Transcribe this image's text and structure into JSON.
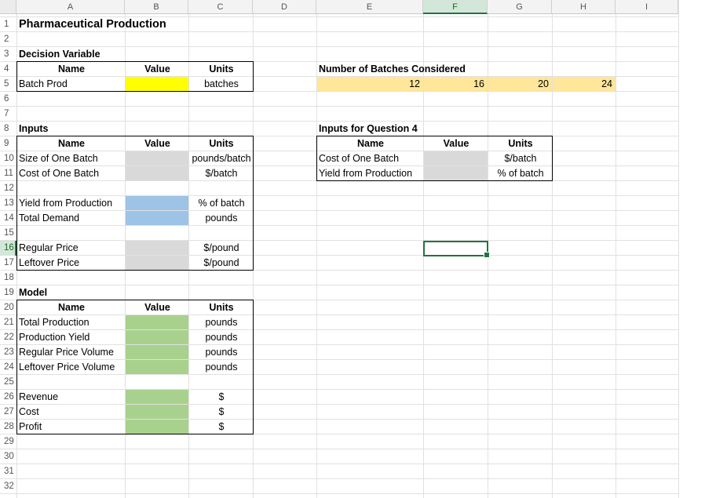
{
  "columns": [
    "A",
    "B",
    "C",
    "D",
    "E",
    "F",
    "G",
    "H",
    "I"
  ],
  "rows": [
    "1",
    "2",
    "3",
    "4",
    "5",
    "6",
    "7",
    "8",
    "9",
    "10",
    "11",
    "12",
    "13",
    "14",
    "15",
    "16",
    "17",
    "18",
    "19",
    "20",
    "21",
    "22",
    "23",
    "24",
    "25",
    "26",
    "27",
    "28",
    "29",
    "30",
    "31",
    "32"
  ],
  "title": "Pharmaceutical Production",
  "decision": {
    "heading": "Decision Variable",
    "name_header": "Name",
    "value_header": "Value",
    "units_header": "Units",
    "rows": [
      {
        "name": "Batch Prod",
        "units": "batches",
        "fill": "#ffff00"
      }
    ]
  },
  "inputs": {
    "heading": "Inputs",
    "name_header": "Name",
    "value_header": "Value",
    "units_header": "Units",
    "rows": [
      {
        "name": "Size of One Batch",
        "units": "pounds/batch",
        "fill": "#d9d9d9"
      },
      {
        "name": "Cost of One Batch",
        "units": "$/batch",
        "fill": "#d9d9d9"
      },
      {
        "name": "Yield from Production",
        "units": "% of batch",
        "fill": "#9dc3e6"
      },
      {
        "name": "Total Demand",
        "units": "pounds",
        "fill": "#9dc3e6"
      },
      {
        "name": "Regular Price",
        "units": "$/pound",
        "fill": "#d9d9d9"
      },
      {
        "name": "Leftover Price",
        "units": "$/pound",
        "fill": "#d9d9d9"
      }
    ]
  },
  "model": {
    "heading": "Model",
    "name_header": "Name",
    "value_header": "Value",
    "units_header": "Units",
    "rows": [
      {
        "name": "Total Production",
        "units": "pounds",
        "fill": "#a9d18e"
      },
      {
        "name": "Production Yield",
        "units": "pounds",
        "fill": "#a9d18e"
      },
      {
        "name": "Regular Price Volume",
        "units": "pounds",
        "fill": "#a9d18e"
      },
      {
        "name": "Leftover Price Volume",
        "units": "pounds",
        "fill": "#a9d18e"
      },
      {
        "name": "Revenue",
        "units": "$",
        "fill": "#a9d18e"
      },
      {
        "name": "Cost",
        "units": "$",
        "fill": "#a9d18e"
      },
      {
        "name": "Profit",
        "units": "$",
        "fill": "#a9d18e"
      }
    ]
  },
  "batches": {
    "heading": "Number of Batches Considered",
    "values": [
      "12",
      "16",
      "20",
      "24"
    ],
    "fill": "#ffe699"
  },
  "q4": {
    "heading": "Inputs for Question 4",
    "name_header": "Name",
    "value_header": "Value",
    "units_header": "Units",
    "rows": [
      {
        "name": "Cost of One Batch",
        "units": "$/batch",
        "fill": "#d9d9d9"
      },
      {
        "name": "Yield from Production",
        "units": "% of batch",
        "fill": "#d9d9d9"
      }
    ]
  },
  "active_cell": {
    "column": "F",
    "row": "16"
  },
  "colors": {
    "selection": "#217346",
    "grid": "#e1e1e1"
  }
}
